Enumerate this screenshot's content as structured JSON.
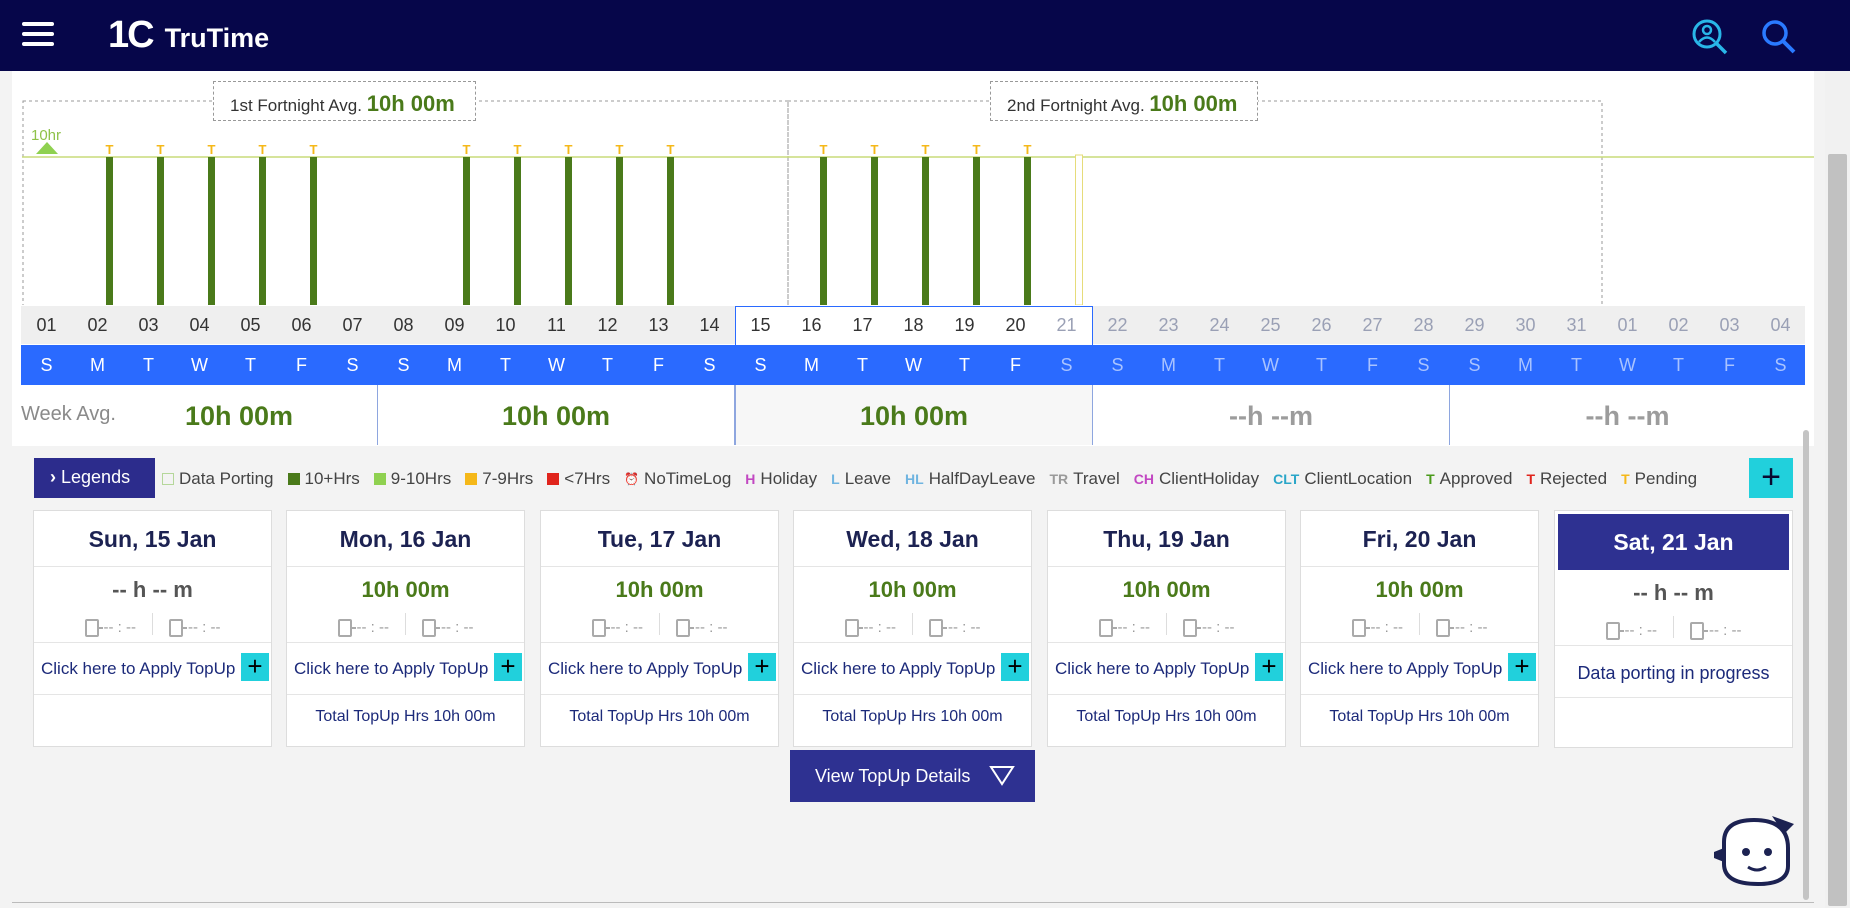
{
  "app": {
    "logo_mark": "1C",
    "logo_text": "TruTime"
  },
  "chart": {
    "target_label": "10hr",
    "fortnight1_label": "1st Fortnight Avg.",
    "fortnight1_value": "10h 00m",
    "fortnight2_label": "2nd Fortnight Avg.",
    "fortnight2_value": "10h 00m",
    "bar_marker": "T"
  },
  "chart_data": {
    "type": "bar",
    "categories": [
      "01",
      "02",
      "03",
      "04",
      "05",
      "06",
      "07",
      "08",
      "09",
      "10",
      "11",
      "12",
      "13",
      "14",
      "15",
      "16",
      "17",
      "18",
      "19",
      "20",
      "21"
    ],
    "values": [
      0,
      10,
      10,
      10,
      10,
      10,
      0,
      0,
      10,
      10,
      10,
      10,
      10,
      0,
      0,
      10,
      10,
      10,
      10,
      10,
      0
    ],
    "status": [
      "",
      "approved",
      "approved",
      "approved",
      "approved",
      "approved",
      "",
      "",
      "approved",
      "approved",
      "approved",
      "approved",
      "approved",
      "",
      "",
      "approved",
      "approved",
      "approved",
      "approved",
      "approved",
      "porting"
    ],
    "target": 10,
    "ylim": [
      0,
      10.5
    ]
  },
  "calendar": {
    "dates": [
      "01",
      "02",
      "03",
      "04",
      "05",
      "06",
      "07",
      "08",
      "09",
      "10",
      "11",
      "12",
      "13",
      "14",
      "15",
      "16",
      "17",
      "18",
      "19",
      "20",
      "21",
      "22",
      "23",
      "24",
      "25",
      "26",
      "27",
      "28",
      "29",
      "30",
      "31",
      "01",
      "02",
      "03",
      "04"
    ],
    "days": [
      "S",
      "M",
      "T",
      "W",
      "T",
      "F",
      "S",
      "S",
      "M",
      "T",
      "W",
      "T",
      "F",
      "S",
      "S",
      "M",
      "T",
      "W",
      "T",
      "F",
      "S",
      "S",
      "M",
      "T",
      "W",
      "T",
      "F",
      "S",
      "S",
      "M",
      "T",
      "W",
      "T",
      "F",
      "S"
    ],
    "future_from": 20
  },
  "week_avg": {
    "label": "Week Avg.",
    "values": [
      "10h 00m",
      "10h 00m",
      "10h 00m",
      "--h --m",
      "--h --m"
    ]
  },
  "legends": {
    "button_label": "Legends",
    "items": [
      {
        "label": "Data Porting",
        "color": "#ffffff",
        "kind": "box"
      },
      {
        "label": "10+Hrs",
        "color": "#4a7a1a",
        "kind": "swatch"
      },
      {
        "label": "9-10Hrs",
        "color": "#8fd150",
        "kind": "swatch"
      },
      {
        "label": "7-9Hrs",
        "color": "#f5b819",
        "kind": "swatch"
      },
      {
        "label": "<7Hrs",
        "color": "#e0241c",
        "kind": "swatch"
      },
      {
        "label": "NoTimeLog",
        "color": "#e55a5a",
        "kind": "clock"
      },
      {
        "label": "Holiday",
        "letter": "H",
        "color": "#c247c2",
        "kind": "letter"
      },
      {
        "label": "Leave",
        "letter": "L",
        "color": "#6fb4e0",
        "kind": "letter"
      },
      {
        "label": "HalfDayLeave",
        "letter": "HL",
        "color": "#6fb4e0",
        "kind": "letter"
      },
      {
        "label": "Travel",
        "letter": "TR",
        "color": "#9a9a9a",
        "kind": "letter"
      },
      {
        "label": "ClientHoliday",
        "letter": "CH",
        "color": "#c247c2",
        "kind": "letter"
      },
      {
        "label": "ClientLocation",
        "letter": "CLT",
        "color": "#2aa6c8",
        "kind": "letter"
      },
      {
        "label": "Approved",
        "letter": "T",
        "color": "#4a9a1a",
        "kind": "letter"
      },
      {
        "label": "Rejected",
        "letter": "T",
        "color": "#e0241c",
        "kind": "letter"
      },
      {
        "label": "Pending",
        "letter": "T",
        "color": "#f5b819",
        "kind": "letter"
      }
    ],
    "add_label": "+"
  },
  "cards": [
    {
      "title": "Sun, 15 Jan",
      "hours": "-- h -- m",
      "in": "-- : --",
      "out": "-- : --",
      "topup": "Click here to Apply TopUp",
      "total": ""
    },
    {
      "title": "Mon, 16 Jan",
      "hours": "10h 00m",
      "in": "-- : --",
      "out": "-- : --",
      "topup": "Click here to Apply TopUp",
      "total": "Total TopUp Hrs 10h 00m"
    },
    {
      "title": "Tue, 17 Jan",
      "hours": "10h 00m",
      "in": "-- : --",
      "out": "-- : --",
      "topup": "Click here to Apply TopUp",
      "total": "Total TopUp Hrs 10h 00m"
    },
    {
      "title": "Wed, 18 Jan",
      "hours": "10h 00m",
      "in": "-- : --",
      "out": "-- : --",
      "topup": "Click here to Apply TopUp",
      "total": "Total TopUp Hrs 10h 00m"
    },
    {
      "title": "Thu, 19 Jan",
      "hours": "10h 00m",
      "in": "-- : --",
      "out": "-- : --",
      "topup": "Click here to Apply TopUp",
      "total": "Total TopUp Hrs 10h 00m"
    },
    {
      "title": "Fri, 20 Jan",
      "hours": "10h 00m",
      "in": "-- : --",
      "out": "-- : --",
      "topup": "Click here to Apply TopUp",
      "total": "Total TopUp Hrs 10h 00m"
    },
    {
      "title": "Sat, 21 Jan",
      "hours": "-- h -- m",
      "in": "-- : --",
      "out": "-- : --",
      "porting": "Data porting in progress",
      "total": ""
    }
  ],
  "view_topup_label": "View TopUp Details",
  "colors": {
    "header": "#06064a",
    "accent": "#2a6aff",
    "green": "#4a7a1a",
    "cyan": "#21d0dc",
    "navy": "#2e3191"
  }
}
